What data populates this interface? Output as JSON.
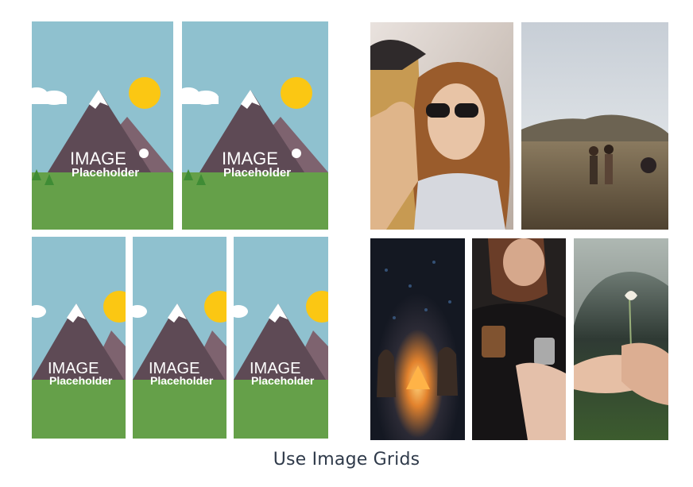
{
  "placeholder": {
    "word_image": "IMAGE",
    "word_placeholder": "Placeholder",
    "colors": {
      "sky": "#8fc1cf",
      "grass": "#65a049",
      "mountain": "#5e4a55",
      "mountain_back": "#7e636f",
      "sun": "#fbc713",
      "snow": "#ffffff",
      "tree": "#3f8c35"
    }
  },
  "photos": [
    {
      "subject": "two-women-laughing-photo"
    },
    {
      "subject": "two-women-walking-field-photo"
    },
    {
      "subject": "campfire-night-photo"
    },
    {
      "subject": "drinks-toast-photo"
    },
    {
      "subject": "hands-holding-flower-photo"
    }
  ],
  "caption": "Use Image Grids"
}
